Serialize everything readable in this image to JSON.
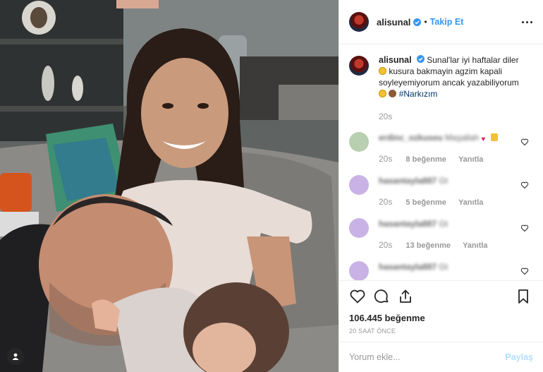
{
  "post": {
    "username": "alisunal",
    "follow_label": "Takip Et",
    "separator": "•",
    "caption": {
      "username": "alisunal",
      "text_line1": "Sunal'lar iyi haftalar diler",
      "text_line2": "kusura bakmayin agzim kapali soyleyemiyorum ancak yazabiliyorum",
      "hashtag": "#Narkızım",
      "time": "20s"
    },
    "comments": [
      {
        "username": "erdinc_ozkuseu",
        "text": "Maşallah",
        "time": "20s",
        "likes": "8 beğenme",
        "reply": "Yanıtla",
        "avatar_color": "#b8cfb0"
      },
      {
        "username": "hasantayla887",
        "text": "Gt",
        "time": "20s",
        "likes": "5 beğenme",
        "reply": "Yanıtla",
        "avatar_color": "#c9b3e6"
      },
      {
        "username": "hasantayla887",
        "text": "Gt",
        "time": "20s",
        "likes": "13 beğenme",
        "reply": "Yanıtla",
        "avatar_color": "#c9b3e6"
      },
      {
        "username": "hasantayla887",
        "text": "Gt",
        "time": "",
        "likes": "",
        "reply": "",
        "avatar_color": "#c9b3e6"
      }
    ],
    "likes_total": "106.445 beğenme",
    "age": "20 SAAT ÖNCE",
    "comment_input": {
      "placeholder": "Yorum ekle...",
      "value": ""
    },
    "post_button": "Paylaş",
    "icons": [
      "heart-icon",
      "comment-icon",
      "share-icon",
      "bookmark-icon",
      "more-options-icon",
      "user-tag-icon",
      "verified-badge-icon"
    ],
    "colors": {
      "accent": "#3897f0",
      "muted": "#999999",
      "divider": "#efefef",
      "post_disabled": "#b2dffc"
    }
  }
}
